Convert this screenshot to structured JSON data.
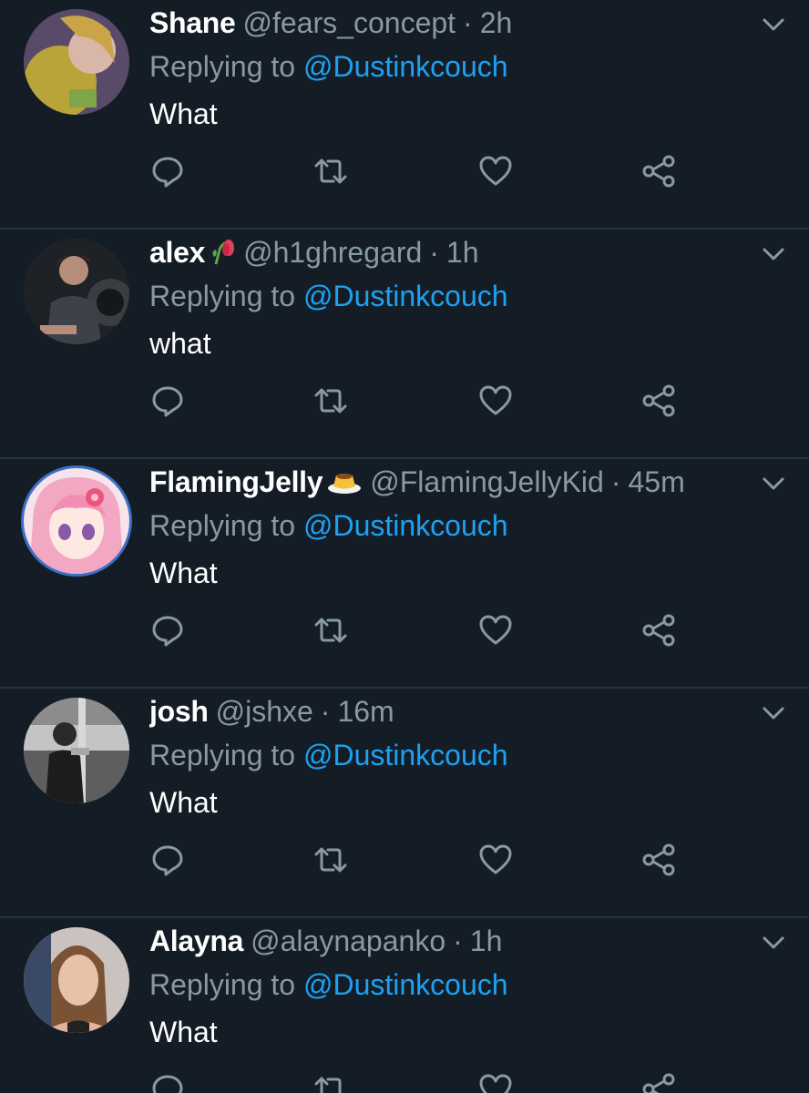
{
  "tweets": [
    {
      "name": "Shane",
      "handle": "@fears_concept",
      "separator": "·",
      "time": "2h",
      "replying_prefix": "Replying to ",
      "replying_to": "@Dustinkcouch",
      "text": "What",
      "name_emoji": ""
    },
    {
      "name": "alex",
      "handle": "@h1ghregard",
      "separator": "·",
      "time": "1h",
      "replying_prefix": "Replying to ",
      "replying_to": "@Dustinkcouch",
      "text": "what",
      "name_emoji": "wilted-flower-icon"
    },
    {
      "name": "FlamingJelly",
      "handle": "@FlamingJellyKid",
      "separator": "·",
      "time": "45m",
      "replying_prefix": "Replying to ",
      "replying_to": "@Dustinkcouch",
      "text": "What",
      "name_emoji": "custard-pudding-icon"
    },
    {
      "name": "josh",
      "handle": "@jshxe",
      "separator": "·",
      "time": "16m",
      "replying_prefix": "Replying to ",
      "replying_to": "@Dustinkcouch",
      "text": "What",
      "name_emoji": ""
    },
    {
      "name": "Alayna",
      "handle": "@alaynapanko",
      "separator": "·",
      "time": "1h",
      "replying_prefix": "Replying to ",
      "replying_to": "@Dustinkcouch",
      "text": "What",
      "name_emoji": ""
    }
  ],
  "icons": {
    "reply": "reply-icon",
    "retweet": "retweet-icon",
    "like": "heart-icon",
    "share": "share-icon",
    "menu": "chevron-down-icon"
  },
  "colors": {
    "background": "#141d26",
    "divider": "#263340",
    "secondary_text": "#8899a6",
    "link": "#1da1f2",
    "primary_text": "#ffffff"
  }
}
